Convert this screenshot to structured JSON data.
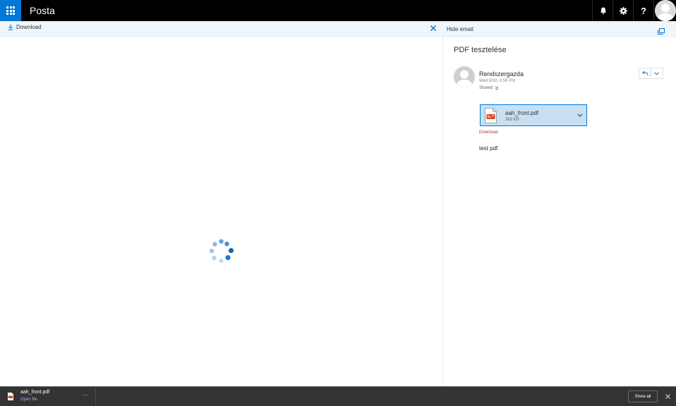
{
  "app": {
    "title": "Posta"
  },
  "topbar": {
    "icons": [
      "app-launcher-icon",
      "bell-icon",
      "gear-icon",
      "help-icon",
      "avatar"
    ],
    "help_glyph": "?"
  },
  "commandbar": {
    "download_label": "Download",
    "hide_email_label": "Hide email"
  },
  "message": {
    "subject": "PDF tesztelése",
    "sender": "Rendszergazda",
    "date": "Wed 9/30, 6:56 PM",
    "shared_label": "Shared",
    "attachment": {
      "name": "aah_front.pdf",
      "size": "363 KB",
      "download_label": "Download"
    },
    "body": "test pdf"
  },
  "downloads_bar": {
    "file_name": "aah_front.pdf",
    "open_label": "Open file",
    "more_label": "···",
    "show_all_label": "Show all"
  },
  "colors": {
    "accent": "#0078d7",
    "topbar_bg": "#000000",
    "commandbar_bg": "#eff6fc",
    "attachment_bg": "#c7e0f4",
    "downloads_bar_bg": "#333333",
    "pdf_red": "#d24726"
  }
}
